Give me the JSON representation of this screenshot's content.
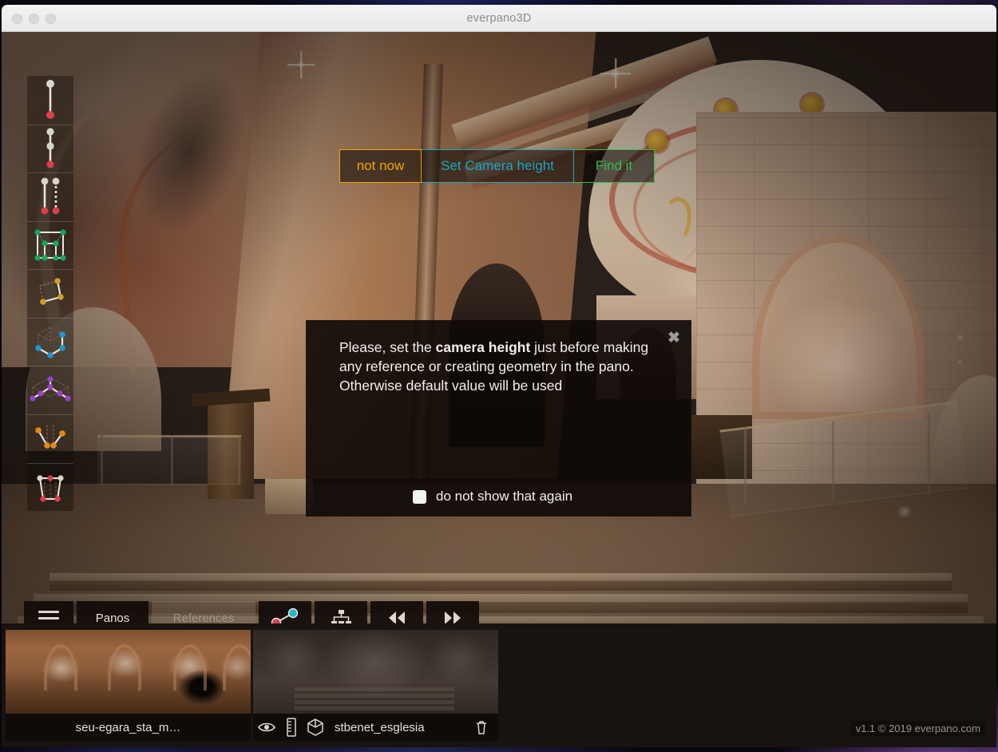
{
  "window": {
    "title": "everpano3D",
    "traffic_lights": [
      "close",
      "minimize",
      "zoom"
    ]
  },
  "tool_rail": {
    "tools": [
      {
        "id": "single-line-tool",
        "name": "single-line-tool",
        "title": "Vertical line reference"
      },
      {
        "id": "double-line-tool",
        "name": "double-line-tool",
        "title": "Double vertical reference"
      },
      {
        "id": "parallel-lines-tool",
        "name": "parallel-lines-tool",
        "title": "Parallel lines reference"
      },
      {
        "id": "wall-tool",
        "name": "wall-tool",
        "title": "Wall geometry"
      },
      {
        "id": "plane-tool",
        "name": "plane-tool",
        "title": "Plane geometry"
      },
      {
        "id": "box-tool",
        "name": "box-tool",
        "title": "Box geometry"
      },
      {
        "id": "roof-tool",
        "name": "roof-tool",
        "title": "Roof geometry"
      },
      {
        "id": "angle-tool",
        "name": "angle-tool",
        "title": "Angle reference"
      },
      {
        "id": "frustum-tool",
        "name": "frustum-tool",
        "title": "Camera frustum"
      }
    ]
  },
  "dialog": {
    "text_before": "Please, set the ",
    "text_bold": "camera height",
    "text_after": " just before making any reference or creating geometry in the pano. Otherwise default value will be used",
    "close_icon": "close-icon",
    "buttons": {
      "not_now": "not now",
      "set_camera_height": "Set Camera height",
      "find_it": "Find it"
    },
    "checkbox_label": "do not show that again",
    "checkbox_checked": false,
    "colors": {
      "not_now": "#f0a500",
      "set_camera_height": "#1aa7c4",
      "find_it": "#2fbf50"
    }
  },
  "toolbar": {
    "menu_icon": "hamburger-icon",
    "panos_label": "Panos",
    "references_label": "References",
    "references_disabled": true,
    "connection_icon": "connect-points-icon",
    "tree_icon": "hierarchy-icon",
    "prev_icon": "rewind-icon",
    "next_icon": "fast-forward-icon"
  },
  "strip": {
    "thumbnails": [
      {
        "name": "seu-egara_sta_m…",
        "selected": true,
        "icons": []
      },
      {
        "name": "stbenet_esglesia",
        "selected": false,
        "icons": [
          "eye-icon",
          "ruler-icon",
          "cube-icon",
          "trash-icon"
        ]
      }
    ]
  },
  "footer": {
    "version": "v1.1 © 2019 everpano.com"
  }
}
